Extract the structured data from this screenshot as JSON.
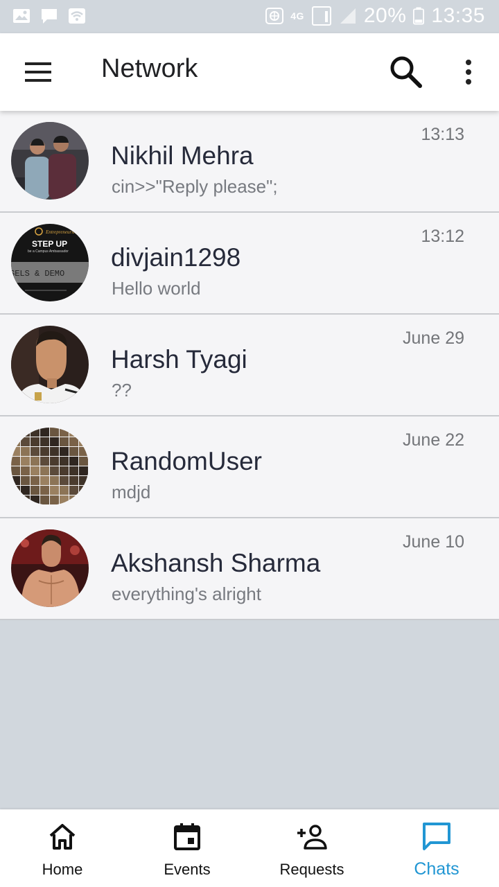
{
  "status_bar": {
    "battery": "20%",
    "time": "13:35",
    "network": "4G"
  },
  "app_bar": {
    "title": "Network",
    "icons": [
      "menu-icon",
      "search-icon",
      "more-vert-icon"
    ]
  },
  "chats": [
    {
      "name": "Nikhil Mehra",
      "message": "cin>>\"Reply please\";",
      "time": "13:13",
      "avatar": "photo-two-people"
    },
    {
      "name": "divjain1298",
      "message": "Hello world",
      "time": "13:12",
      "avatar": "step-up-poster"
    },
    {
      "name": "Harsh Tyagi",
      "message": "??",
      "time": "June 29",
      "avatar": "photo-footballer"
    },
    {
      "name": "RandomUser",
      "message": "mdjd",
      "time": "June 22",
      "avatar": "wood-tiles"
    },
    {
      "name": "Akshansh Sharma",
      "message": "everything's alright",
      "time": "June 10",
      "avatar": "photo-athlete"
    }
  ],
  "avatar_text": {
    "brand": "Entrepreneurship",
    "headline": "STEP UP",
    "tagline": "be a Campus Ambassador",
    "band": "SELS  &  DEMO"
  },
  "bottom_nav": [
    {
      "label": "Home",
      "icon": "home-icon",
      "active": false
    },
    {
      "label": "Events",
      "icon": "calendar-icon",
      "active": false
    },
    {
      "label": "Requests",
      "icon": "add-person-icon",
      "active": false
    },
    {
      "label": "Chats",
      "icon": "chat-icon",
      "active": true
    }
  ],
  "colors": {
    "accent": "#2196d3",
    "background": "#d1d7dd",
    "row_bg": "#f5f5f7",
    "name_text": "#262a3a"
  }
}
